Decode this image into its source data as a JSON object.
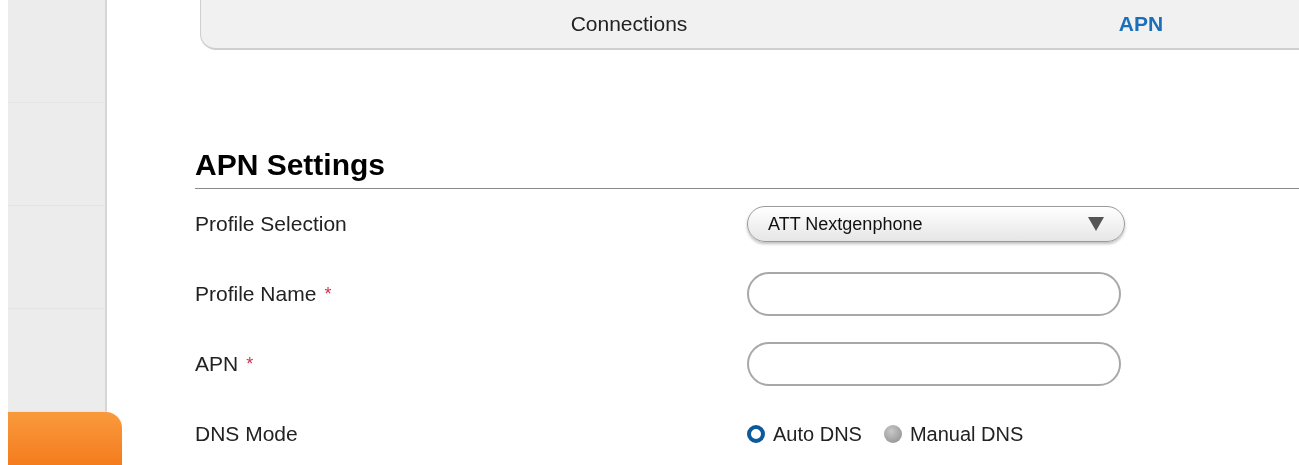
{
  "sidebar": {
    "items": [
      {
        "selected": false
      },
      {
        "selected": false
      },
      {
        "selected": false
      },
      {
        "selected": false
      },
      {
        "selected": true
      }
    ]
  },
  "tabs": [
    {
      "label": "Connections",
      "selected": false
    },
    {
      "label": "APN",
      "selected": true
    }
  ],
  "section": {
    "title": "APN Settings"
  },
  "fields": [
    {
      "kind": "select",
      "label": "Profile Selection",
      "required": false,
      "value": "ATT Nextgenphone"
    },
    {
      "kind": "text",
      "label": "Profile Name",
      "required": true
    },
    {
      "kind": "text",
      "label": "APN",
      "required": true
    },
    {
      "kind": "radio",
      "label": "DNS Mode",
      "required": false,
      "options": [
        {
          "label": "Auto DNS",
          "selected": true
        },
        {
          "label": "Manual DNS",
          "selected": false
        }
      ]
    }
  ],
  "required_mark": "*"
}
